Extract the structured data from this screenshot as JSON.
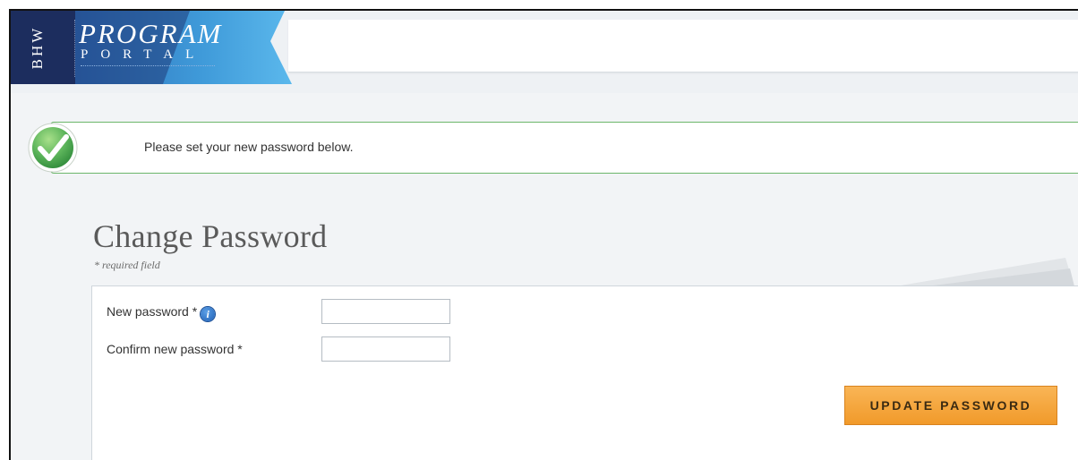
{
  "header": {
    "logo": {
      "abbr": "BHW",
      "line1": "PROGRAM",
      "line2": "PORTAL"
    }
  },
  "banner": {
    "message": "Please set your new password below.",
    "status": "success",
    "icon": "checkmark-icon"
  },
  "page": {
    "title": "Change Password",
    "required_note": "* required field"
  },
  "form": {
    "new_password": {
      "label": "New password *",
      "value": "",
      "info_icon": "info-icon"
    },
    "confirm_password": {
      "label": "Confirm new password *",
      "value": ""
    },
    "submit_label": "UPDATE PASSWORD"
  },
  "colors": {
    "logo_navy": "#1c2d5e",
    "logo_blue": "#3f9ad9",
    "success_green": "#5db55b",
    "button_orange": "#f5a23a"
  }
}
